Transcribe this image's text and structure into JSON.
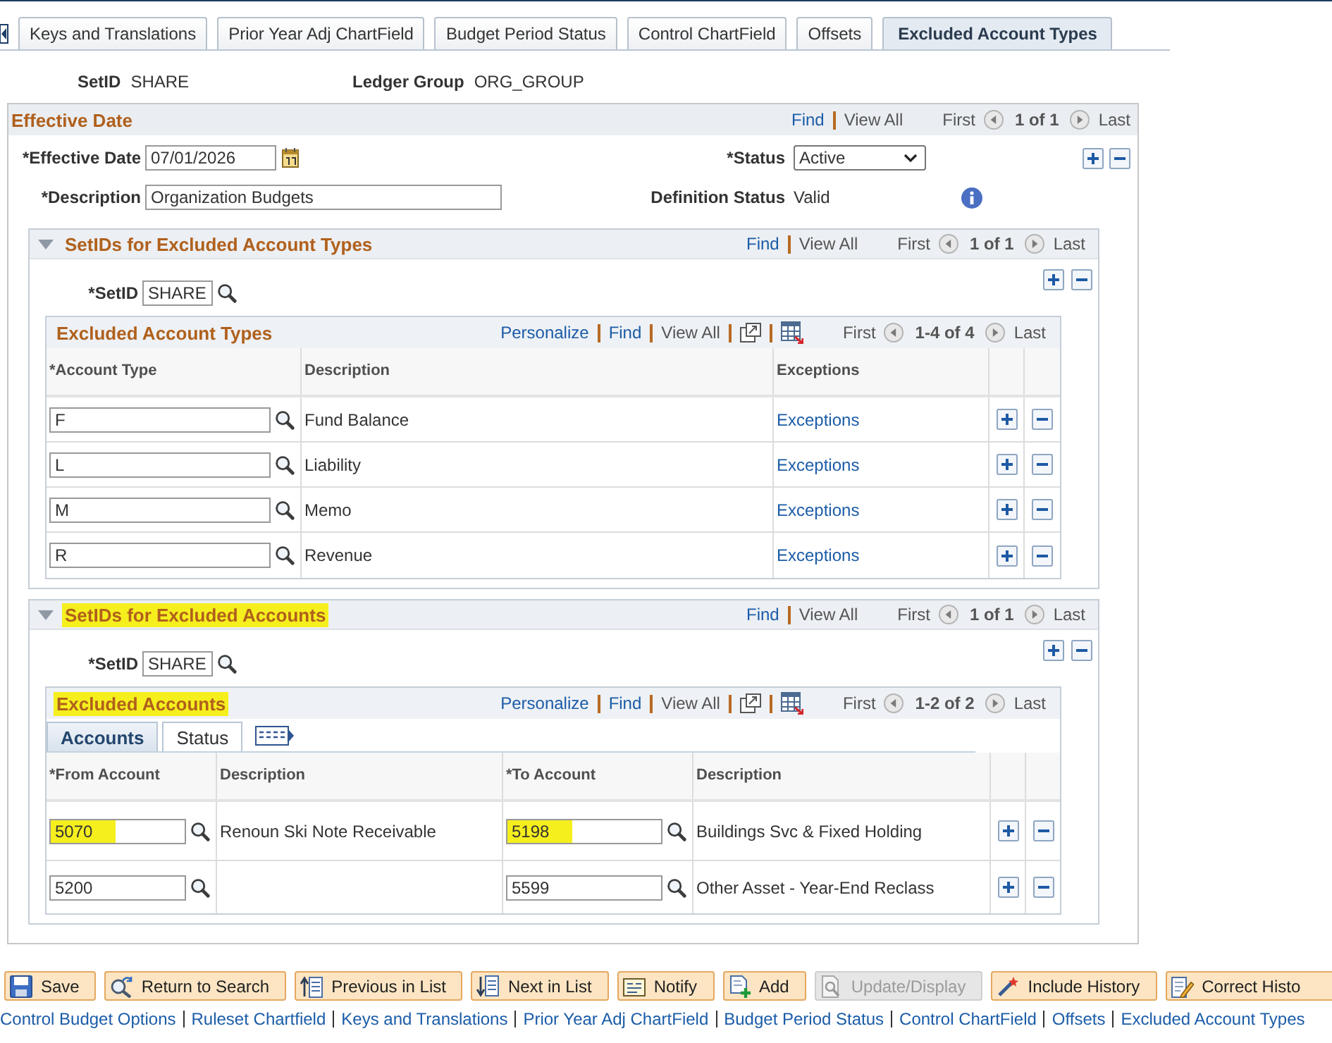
{
  "tabs": [
    {
      "label": "Keys and Translations",
      "selected": false
    },
    {
      "label": "Prior Year Adj ChartField",
      "selected": false
    },
    {
      "label": "Budget Period Status",
      "selected": false
    },
    {
      "label": "Control ChartField",
      "selected": false
    },
    {
      "label": "Offsets",
      "selected": false
    },
    {
      "label": "Excluded Account Types",
      "selected": true
    }
  ],
  "header": [
    {
      "label": "SetID",
      "value": "SHARE"
    },
    {
      "label": "Ledger Group",
      "value": "ORG_GROUP"
    }
  ],
  "effective_date": {
    "title": "Effective Date",
    "nav": {
      "find": "Find",
      "view_all": "View All",
      "first": "First",
      "count": "1 of 1",
      "last": "Last"
    },
    "effective_date": {
      "label": "*Effective Date",
      "value": "07/01/2026"
    },
    "status": {
      "label": "*Status",
      "value": "Active"
    },
    "description": {
      "label": "*Description",
      "value": "Organization Budgets"
    },
    "definition_status": {
      "label": "Definition Status",
      "value": "Valid"
    }
  },
  "sections": [
    {
      "title": "SetIDs for Excluded Account Types",
      "highlighted": false,
      "nav": {
        "find": "Find",
        "view_all": "View All",
        "first": "First",
        "count": "1 of 1",
        "last": "Last"
      },
      "setid": {
        "label": "*SetID",
        "value": "SHARE"
      },
      "grid": {
        "kind": "types",
        "title": "Excluded Account Types",
        "highlighted": false,
        "nav": {
          "personalize": "Personalize",
          "find": "Find",
          "view_all": "View All",
          "first": "First",
          "count": "1-4 of 4",
          "last": "Last"
        },
        "columns": [
          "*Account Type",
          "Description",
          "Exceptions"
        ],
        "rows": [
          {
            "cells": [
              {
                "kind": "input",
                "value": "F",
                "highlighted": false
              },
              {
                "kind": "text",
                "value": "Fund Balance"
              },
              {
                "kind": "link",
                "value": "Exceptions"
              }
            ]
          },
          {
            "cells": [
              {
                "kind": "input",
                "value": "L",
                "highlighted": false
              },
              {
                "kind": "text",
                "value": "Liability"
              },
              {
                "kind": "link",
                "value": "Exceptions"
              }
            ]
          },
          {
            "cells": [
              {
                "kind": "input",
                "value": "M",
                "highlighted": false
              },
              {
                "kind": "text",
                "value": "Memo"
              },
              {
                "kind": "link",
                "value": "Exceptions"
              }
            ]
          },
          {
            "cells": [
              {
                "kind": "input",
                "value": "R",
                "highlighted": false
              },
              {
                "kind": "text",
                "value": "Revenue"
              },
              {
                "kind": "link",
                "value": "Exceptions"
              }
            ]
          }
        ]
      }
    },
    {
      "title": "SetIDs for Excluded Accounts",
      "highlighted": true,
      "nav": {
        "find": "Find",
        "view_all": "View All",
        "first": "First",
        "count": "1 of 1",
        "last": "Last"
      },
      "setid": {
        "label": "*SetID",
        "value": "SHARE"
      },
      "grid": {
        "kind": "accounts",
        "title": "Excluded Accounts",
        "highlighted": true,
        "nav": {
          "personalize": "Personalize",
          "find": "Find",
          "view_all": "View All",
          "first": "First",
          "count": "1-2 of 2",
          "last": "Last"
        },
        "tabs": [
          {
            "label": "Accounts",
            "selected": true
          },
          {
            "label": "Status",
            "selected": false
          }
        ],
        "columns": [
          "*From Account",
          "Description",
          "*To Account",
          "Description"
        ],
        "rows": [
          {
            "cells": [
              {
                "kind": "input",
                "value": "5070",
                "highlighted": true
              },
              {
                "kind": "text",
                "value": "Renoun Ski Note Receivable"
              },
              {
                "kind": "input",
                "value": "5198",
                "highlighted": true
              },
              {
                "kind": "text",
                "value": "Buildings Svc & Fixed Holding"
              }
            ]
          },
          {
            "cells": [
              {
                "kind": "input",
                "value": "5200",
                "highlighted": false
              },
              {
                "kind": "text"
              },
              {
                "kind": "input",
                "value": "5599",
                "highlighted": false
              },
              {
                "kind": "text",
                "value": "Other Asset - Year-End Reclass"
              }
            ]
          }
        ]
      }
    }
  ],
  "toolbar": [
    {
      "label": "Save",
      "disabled": false
    },
    {
      "label": "Return to Search",
      "disabled": false
    },
    {
      "label": "Previous in List",
      "disabled": false
    },
    {
      "label": "Next in List",
      "disabled": false
    },
    {
      "label": "Notify",
      "disabled": false
    },
    {
      "label": "Add",
      "disabled": false
    },
    {
      "label": "Update/Display",
      "disabled": true
    },
    {
      "label": "Include History",
      "disabled": false
    },
    {
      "label": "Correct Histo",
      "disabled": false
    }
  ],
  "footer_links": [
    "Control Budget Options",
    "Ruleset Chartfield",
    "Keys and Translations",
    "Prior Year Adj ChartField",
    "Budget Period Status",
    "Control ChartField",
    "Offsets",
    "Excluded Account Types"
  ]
}
